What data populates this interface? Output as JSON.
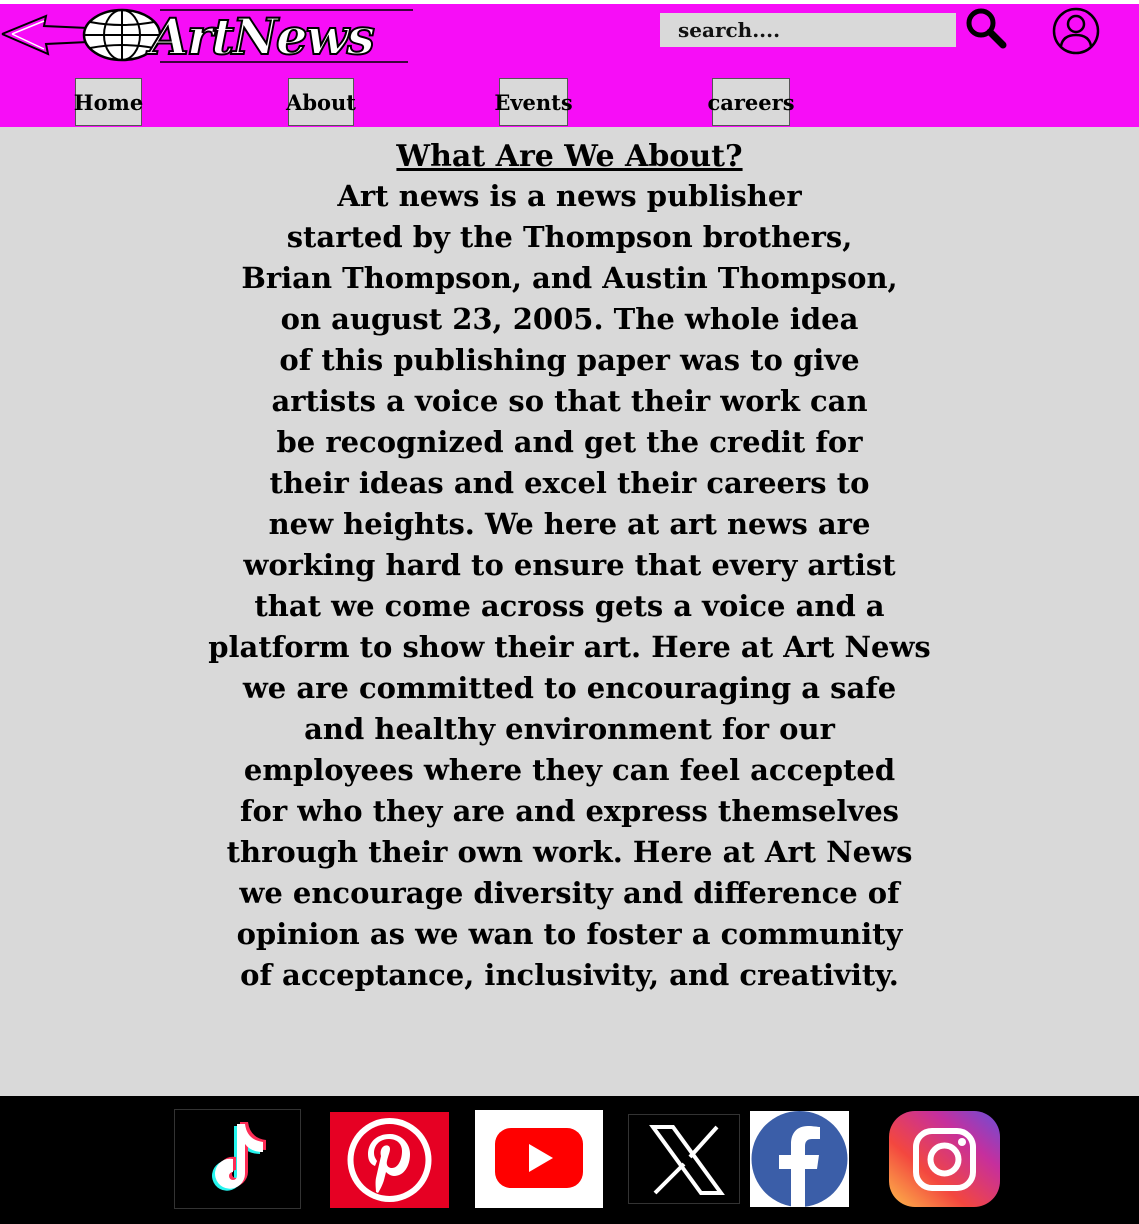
{
  "header": {
    "logo_text": "ArtNews",
    "search_placeholder": "search....",
    "nav": [
      {
        "label": "Home"
      },
      {
        "label": "About"
      },
      {
        "label": "Events"
      },
      {
        "label": "careers"
      }
    ]
  },
  "about": {
    "title": "What Are We About?",
    "lines": [
      "Art news is a news publisher",
      "started by the Thompson brothers,",
      "Brian Thompson, and Austin Thompson,",
      "on august 23, 2005. The whole idea",
      "of this publishing  paper was to give",
      "artists a voice so that their work can",
      "be recognized and get the credit for",
      "their ideas and excel their careers to",
      "new heights. We here at art news are",
      "working hard to ensure that every artist",
      "that we come across gets a voice and a",
      "platform to show their art. Here at Art News",
      "we are committed to encouraging a safe",
      "and healthy environment for our",
      "employees where they can feel accepted",
      "for who they are and express themselves",
      "through their own work. Here at Art News",
      "we encourage diversity and difference of",
      "opinion as we wan to foster a community",
      "of acceptance, inclusivity, and creativity."
    ]
  },
  "social": {
    "icons": [
      "tiktok-icon",
      "pinterest-icon",
      "youtube-icon",
      "x-icon",
      "facebook-icon",
      "instagram-icon"
    ]
  },
  "colors": {
    "header_bg": "#f70df7",
    "page_bg": "#d9d9d9",
    "footer_bg": "#000000"
  }
}
